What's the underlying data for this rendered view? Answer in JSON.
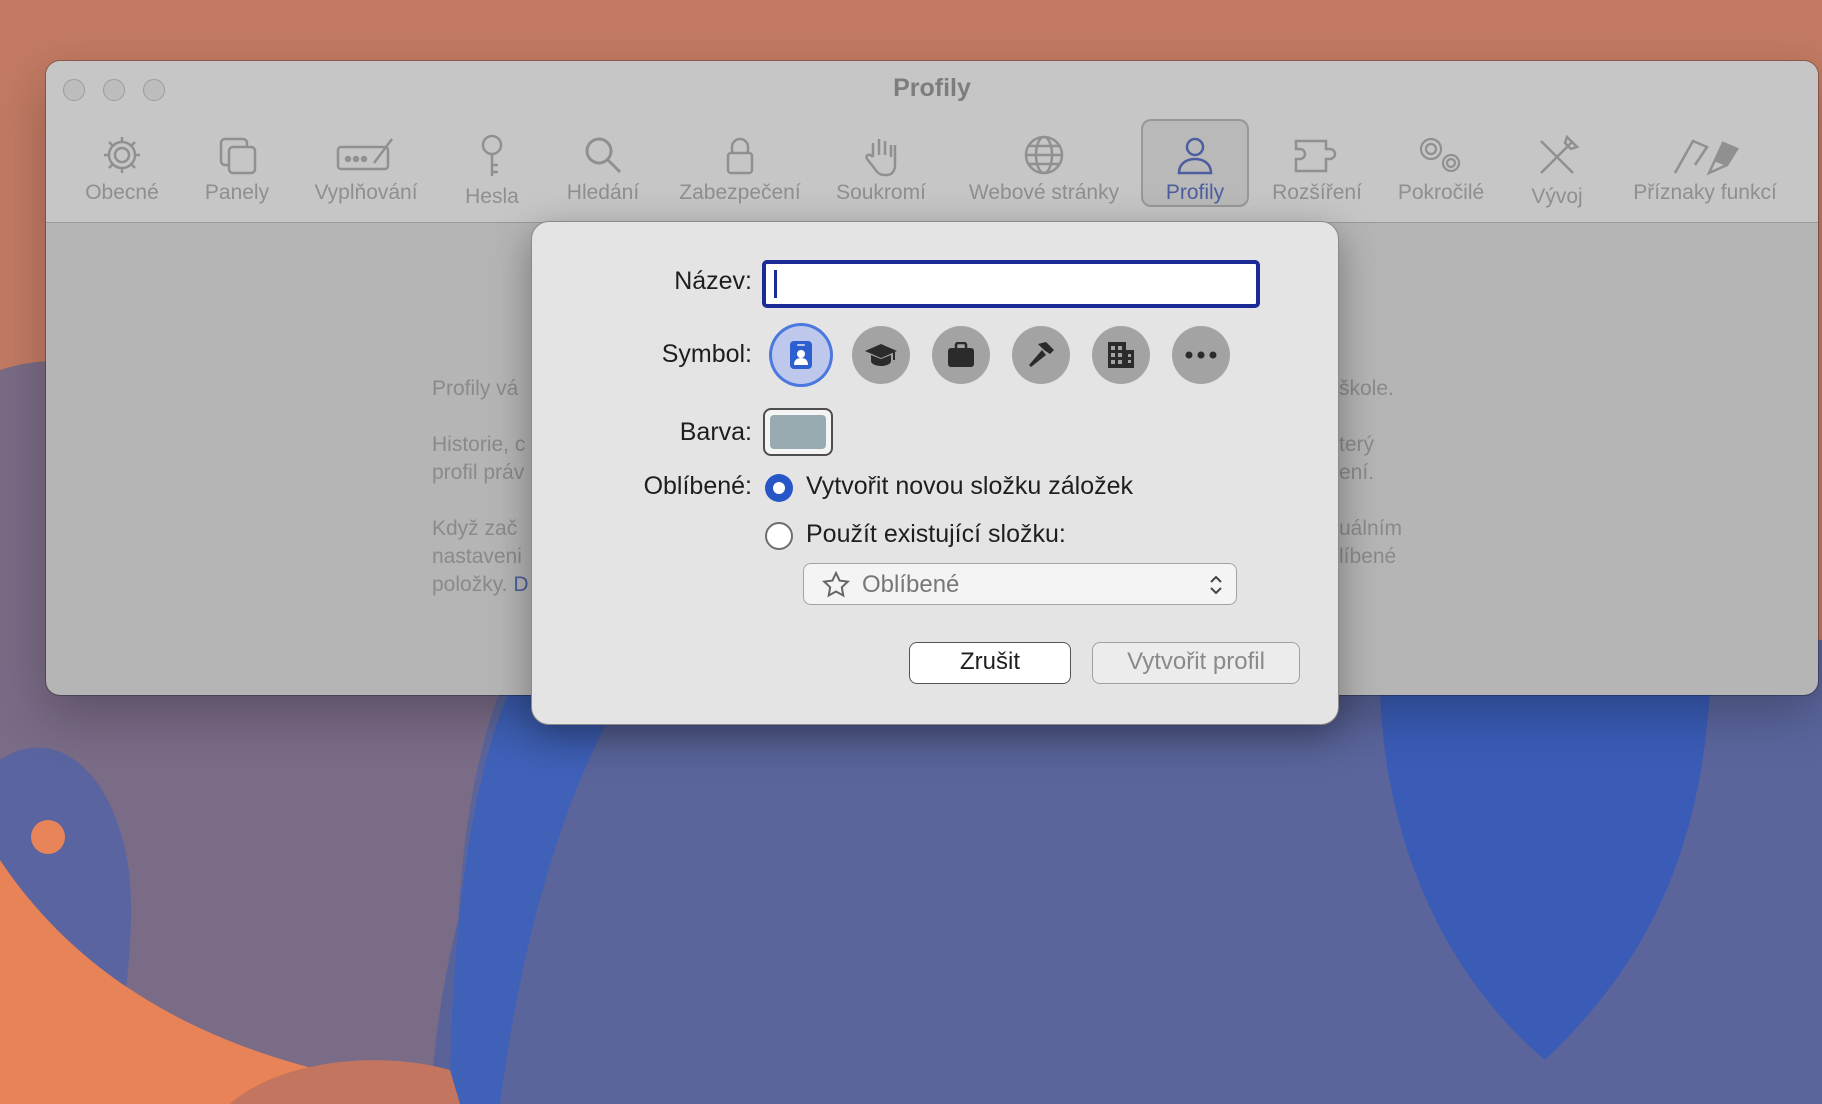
{
  "window": {
    "title": "Profily"
  },
  "toolbar": {
    "items": [
      {
        "label": "Obecné",
        "icon": "gear-icon"
      },
      {
        "label": "Panely",
        "icon": "tabs-icon"
      },
      {
        "label": "Vyplňování",
        "icon": "autofill-icon"
      },
      {
        "label": "Hesla",
        "icon": "key-icon"
      },
      {
        "label": "Hledání",
        "icon": "search-icon"
      },
      {
        "label": "Zabezpečení",
        "icon": "lock-icon"
      },
      {
        "label": "Soukromí",
        "icon": "hand-icon"
      },
      {
        "label": "Webové stránky",
        "icon": "globe-icon"
      },
      {
        "label": "Profily",
        "icon": "person-icon"
      },
      {
        "label": "Rozšíření",
        "icon": "puzzle-icon"
      },
      {
        "label": "Pokročilé",
        "icon": "gears-icon"
      },
      {
        "label": "Vývoj",
        "icon": "tools-icon"
      },
      {
        "label": "Příznaky funkcí",
        "icon": "flags-icon"
      }
    ],
    "active": "Profily"
  },
  "background_text": {
    "left": [
      "Profily vá",
      "Historie, c",
      "profil práv",
      "Když zač",
      "nastaveni",
      "položky."
    ],
    "right": [
      "škole.",
      "terý",
      "ení.",
      "uálním",
      "líbené"
    ],
    "link_fragment": "D"
  },
  "dialog": {
    "name_label": "Název:",
    "name_value": "",
    "symbol_label": "Symbol:",
    "symbols": [
      "person-badge-icon",
      "graduation-cap-icon",
      "briefcase-icon",
      "hammer-icon",
      "building-icon",
      "more-icon"
    ],
    "selected_symbol": "person-badge-icon",
    "color_label": "Barva:",
    "color_value": "#97abb0",
    "favorites_label": "Oblíbené:",
    "option_new": "Vytvořit novou složku záložek",
    "option_existing": "Použít existující složku:",
    "selected_option": "new",
    "folder_popup": "Oblíbené",
    "cancel_button": "Zrušit",
    "create_button": "Vytvořit profil"
  },
  "colors": {
    "accent": "#2757c7",
    "focus_ring": "#1b2a97",
    "active_tab_label": "#4d5e9e"
  }
}
